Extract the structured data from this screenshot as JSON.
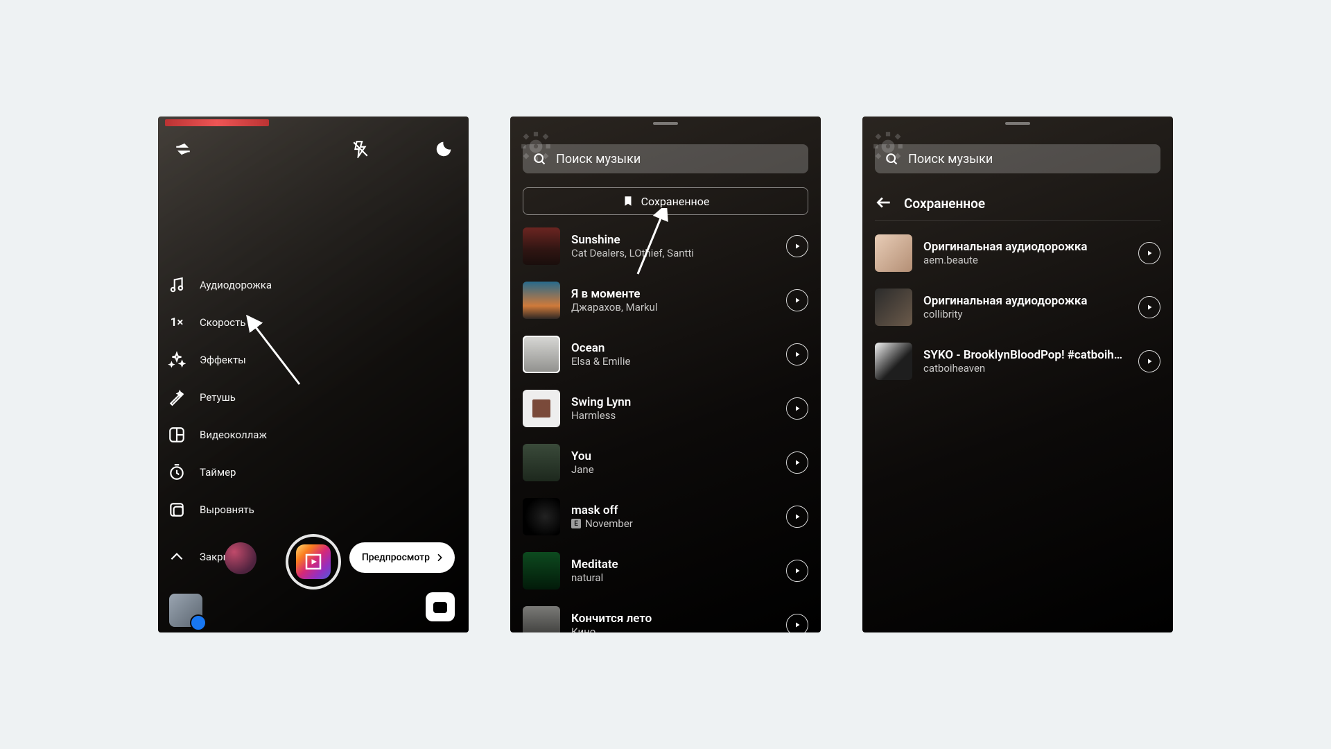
{
  "phone1": {
    "sideMenu": {
      "audio": "Аудиодорожка",
      "speed": "Скорость",
      "speedIconText": "1×",
      "effects": "Эффекты",
      "touchup": "Ретушь",
      "collage": "Видеоколлаж",
      "timer": "Таймер",
      "align": "Выровнять",
      "close": "Закрыть"
    },
    "previewButton": "Предпросмотр"
  },
  "music": {
    "searchPlaceholder": "Поиск музыки",
    "savedButton": "Сохраненное",
    "savedTitle": "Сохраненное"
  },
  "phone2Tracks": [
    {
      "title": "Sunshine",
      "artist": "Cat Dealers, LOthief, Santti",
      "cover": "c-sunshine",
      "explicit": false
    },
    {
      "title": "Я в моменте",
      "artist": "Джарахов, Markul",
      "cover": "c-moment",
      "explicit": false,
      "selected": false
    },
    {
      "title": "Ocean",
      "artist": "Elsa & Emilie",
      "cover": "c-ocean",
      "explicit": false,
      "selected": true
    },
    {
      "title": "Swing Lynn",
      "artist": "Harmless",
      "cover": "c-swing",
      "explicit": false
    },
    {
      "title": "You",
      "artist": "Jane",
      "cover": "c-you",
      "explicit": false
    },
    {
      "title": "mask off",
      "artist": "November",
      "cover": "c-mask",
      "explicit": true
    },
    {
      "title": "Meditate",
      "artist": "natural",
      "cover": "c-meditate",
      "explicit": false
    },
    {
      "title": "Кончится лето",
      "artist": "Кино",
      "cover": "c-leto",
      "explicit": false
    }
  ],
  "phone3Tracks": [
    {
      "title": "Оригинальная аудиодорожка",
      "artist": "aem.beaute",
      "cover": "c-aem"
    },
    {
      "title": "Оригинальная аудиодорожка",
      "artist": "collibrity",
      "cover": "c-coll"
    },
    {
      "title": "SYKO - BrooklynBloodPop! #catboiheaven",
      "artist": "catboiheaven",
      "cover": "c-syko"
    }
  ]
}
